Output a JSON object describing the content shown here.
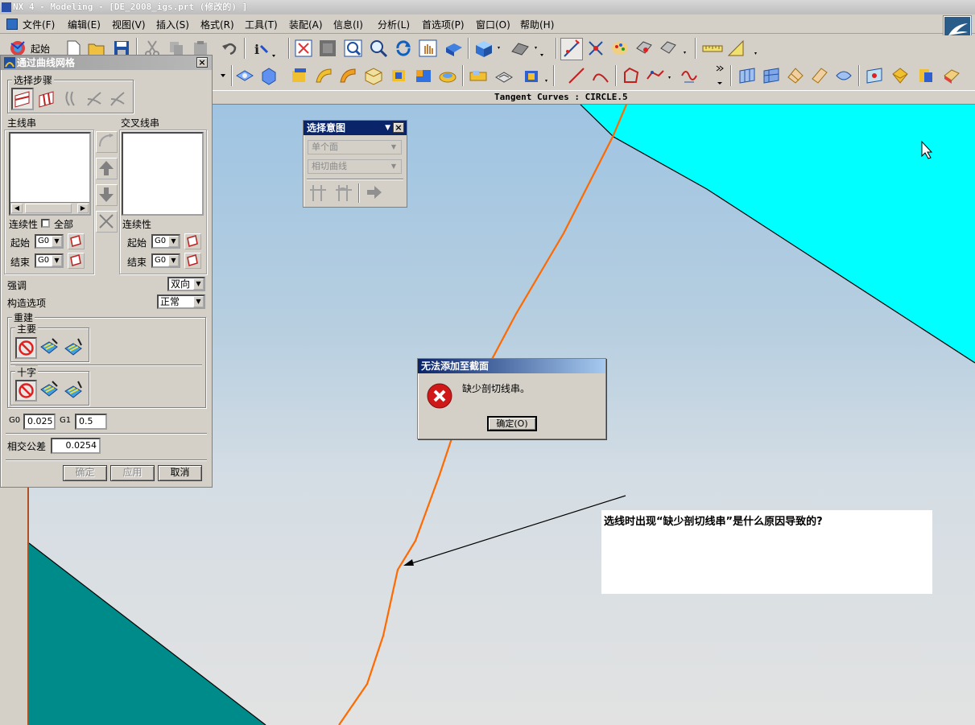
{
  "window": {
    "title": "NX 4 - Modeling - [DE_2008_igs.prt (修改的) ]"
  },
  "menu": [
    "文件(F)",
    "编辑(E)",
    "视图(V)",
    "插入(S)",
    "格式(R)",
    "工具(T)",
    "装配(A)",
    "信息(I)",
    "分析(L)",
    "首选项(P)",
    "窗口(O)",
    "帮助(H)"
  ],
  "toolbar": {
    "start_label": "起始"
  },
  "status": {
    "text": "Tangent Curves : CIRCLE.5"
  },
  "curve_mesh_dialog": {
    "title": "通过曲线网格",
    "steps_label": "选择步骤",
    "primary_label": "主线串",
    "cross_label": "交叉线串",
    "continuity_label": "连续性",
    "all_label": "全部",
    "continuity_label_2": "连续性",
    "start_label": "起始",
    "end_label": "结束",
    "start_value": "G0",
    "end_value": "G0",
    "start_label_2": "起始",
    "end_label_2": "结束",
    "start_value_2": "G0",
    "end_value_2": "G0",
    "emphasis_label": "强调",
    "emphasis_value": "双向",
    "construct_label": "构造选项",
    "construct_value": "正常",
    "rebuild_label": "重建",
    "main_label": "主要",
    "cross_group_label": "十字",
    "g0_label": "G0",
    "g0_value": "0.025",
    "g1_label": "G1",
    "g1_value": "0.5",
    "tolerance_label": "相交公差",
    "tolerance_value": "0.0254",
    "ok_label": "确定",
    "apply_label": "应用",
    "cancel_label": "取消"
  },
  "selection_intent": {
    "title": "选择意图",
    "face_option": "单个面",
    "curve_option": "相切曲线"
  },
  "error_dialog": {
    "title": "无法添加至截面",
    "message": "缺少剖切线串。",
    "ok_label": "确定(O)"
  },
  "annotation": {
    "question": "选线时出现“缺少剖切线串”是什么原因导致的?"
  },
  "colors": {
    "cyan_face": "#00ffff",
    "teal_face": "#008b8b",
    "curve": "#ff6a00",
    "title_active": "#0a246a"
  }
}
